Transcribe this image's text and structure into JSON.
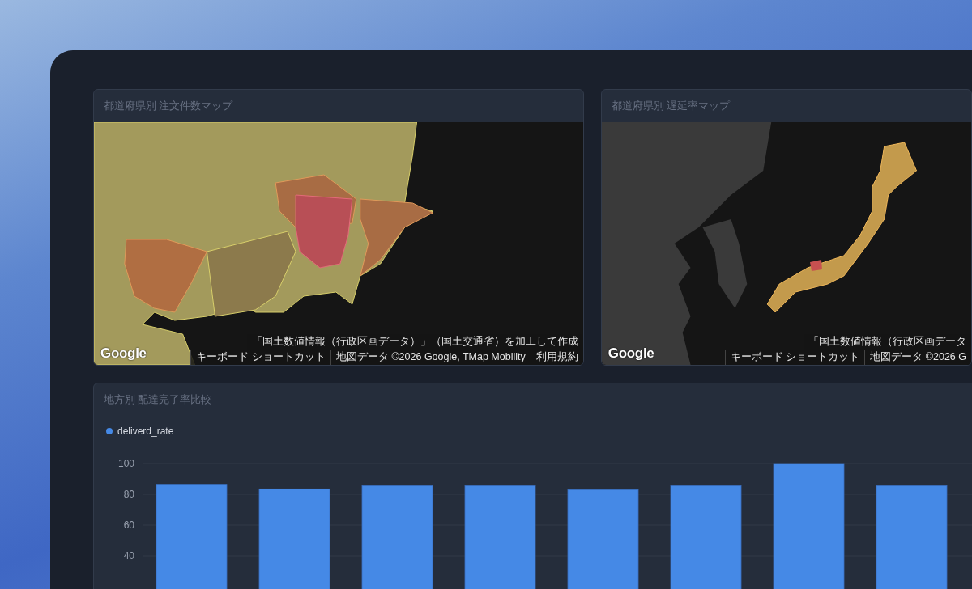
{
  "maps": [
    {
      "title": "都道府県別 注文件数マップ",
      "logo": "Google",
      "attribution": "「国土数値情報（行政区画データ）」（国土交通省）を加工して作成",
      "links": [
        "キーボード ショートカット",
        "地図データ ©2026 Google, TMap Mobility",
        "利用規約"
      ],
      "kind": "region"
    },
    {
      "title": "都道府県別 遅延率マップ",
      "logo": "Google",
      "attribution": "「国土数値情報（行政区画データ",
      "links": [
        "キーボード ショートカット",
        "地図データ ©2026 G"
      ],
      "kind": "country"
    }
  ],
  "chart_panel": {
    "title": "地方別 配達完了率比較",
    "chart_data": {
      "type": "bar",
      "grid": true,
      "ylim": [
        0,
        100
      ],
      "yticks": [
        40,
        60,
        80,
        100
      ],
      "series": [
        {
          "name": "deliverd_rate",
          "color": "#4589e6",
          "values": [
            86.5,
            83.5,
            85.5,
            85.5,
            83,
            85.5,
            100,
            85.5
          ]
        }
      ]
    }
  }
}
